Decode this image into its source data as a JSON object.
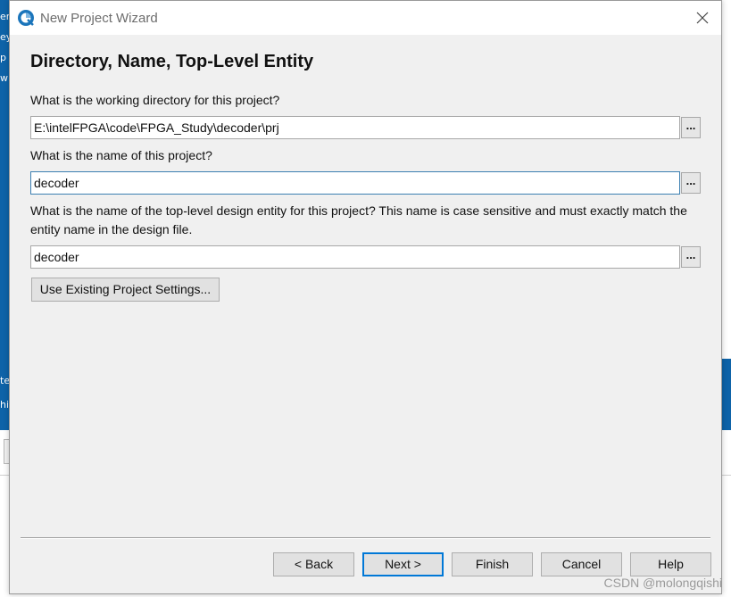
{
  "window": {
    "title": "New Project Wizard",
    "icon": "quartus-logo-icon",
    "close_icon": "close-icon"
  },
  "background_app": {
    "fragments": [
      "er",
      "ey",
      "p",
      "w",
      "te",
      "hi"
    ]
  },
  "page": {
    "heading": "Directory, Name, Top-Level Entity",
    "working_dir": {
      "label": "What is the working directory for this project?",
      "value": "E:\\intelFPGA\\code\\FPGA_Study\\decoder\\prj",
      "browse_label": "..."
    },
    "project_name": {
      "label": "What is the name of this project?",
      "value": "decoder",
      "browse_label": "..."
    },
    "top_entity": {
      "label": "What is the name of the top-level design entity for this project? This name is case sensitive and must exactly match the entity name in the design file.",
      "value": "decoder",
      "browse_label": "..."
    },
    "use_existing_label": "Use Existing Project Settings..."
  },
  "footer": {
    "back": "< Back",
    "next": "Next >",
    "finish": "Finish",
    "cancel": "Cancel",
    "help": "Help"
  },
  "watermark": "CSDN @molongqishi",
  "colors": {
    "accent": "#0078d7",
    "background_blue": "#0e63a8",
    "dialog_bg": "#f0f0f0"
  }
}
